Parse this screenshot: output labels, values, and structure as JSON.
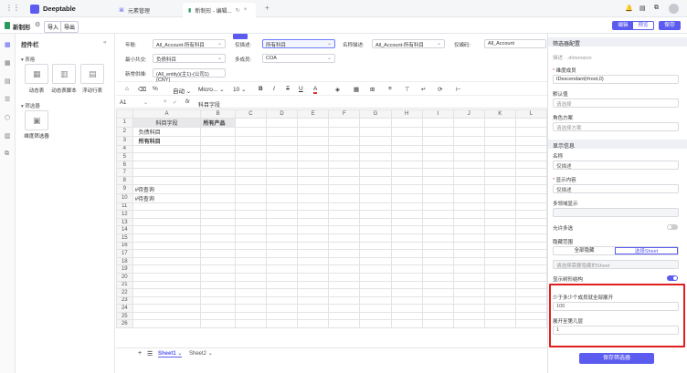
{
  "topbar": {
    "app_name": "Deeptable",
    "tabs": [
      {
        "label": "元素管理"
      },
      {
        "label": "新制形 - 编辑..."
      }
    ]
  },
  "subbar": {
    "doc_name": "新制形",
    "import_label": "导入",
    "export_label": "导出",
    "mode_edit": "编辑",
    "mode_preview": "预览",
    "save_label": "保存"
  },
  "controls_panel": {
    "title": "控件栏",
    "section_table": "表格",
    "items_table": [
      "动态表",
      "动态表脚本",
      "浮动行表"
    ],
    "section_filter": "筛选器",
    "items_filter": [
      "维度筛选器"
    ]
  },
  "filters": {
    "row1": [
      {
        "label": "年账:",
        "value": "All_Account-所有科目"
      },
      {
        "label": "仅描述:",
        "value": "所有科目"
      },
      {
        "label": "名称描述:",
        "value": "All_Account-所有科目"
      },
      {
        "label": "仅编码:",
        "value": "All_Account"
      }
    ],
    "row2": [
      {
        "label": "最小共交:",
        "value": "负债科目"
      },
      {
        "label": "多成员:",
        "value": "COA"
      }
    ],
    "row3": [
      {
        "label": "新常供维:",
        "value": "(All_entity)(主1)-(公司1)(CNY)"
      }
    ]
  },
  "toolbar": {
    "zoom": "自动",
    "font": "Micro...",
    "size": "10"
  },
  "formula_bar": {
    "cell_ref": "A1",
    "fx": "fx",
    "content": "科目字段"
  },
  "sheet": {
    "columns": [
      "A",
      "B",
      "C",
      "D",
      "E",
      "F",
      "G",
      "H",
      "I",
      "J",
      "K",
      "L"
    ],
    "rows": [
      "1",
      "2",
      "3",
      "4",
      "5",
      "6",
      "7",
      "8",
      "9",
      "10",
      "11",
      "12",
      "13",
      "14",
      "15",
      "16",
      "17",
      "18",
      "19",
      "20",
      "21",
      "22",
      "23",
      "24",
      "25",
      "26"
    ],
    "cells": {
      "A1": "科目字段",
      "B1": "所有产品",
      "A2": "负债科目",
      "A3": "所有科目",
      "A9": "#待查询",
      "A10": "#待查询"
    },
    "tabs": [
      "Sheet1",
      "Sheet2"
    ]
  },
  "right_panel": {
    "title": "筛选器配置",
    "desc_label": "描述",
    "desc_value": ".dimension",
    "member_label": "维度成员",
    "member_value": "IDescendant(#root,0)",
    "default_label": "默认值",
    "default_placeholder": "请选择",
    "role_label": "角色方案",
    "role_placeholder": "请选择方案",
    "display_section": "显示信息",
    "name_label": "名称",
    "name_value": "仅描述",
    "show_content_label": "显示内容",
    "show_content_value": "仅描述",
    "multilang_label": "多领域显示",
    "allow_multi_label": "允许多选",
    "hide_range_label": "隐藏范围",
    "seg_all": "全部隐藏",
    "seg_sheet": "选择Sheet",
    "sheet_placeholder": "请选择需要隐藏的Sheet",
    "show_tree_label": "显示树形结构",
    "min_expand_label": "少于多少个成员就全部展开",
    "min_expand_value": "100",
    "expand_level_label": "展开至第几层",
    "expand_level_value": "1",
    "save_filter": "保存筛选器"
  },
  "colors": {
    "accent": "#5b5bf0",
    "highlight_border": "#e02020"
  }
}
